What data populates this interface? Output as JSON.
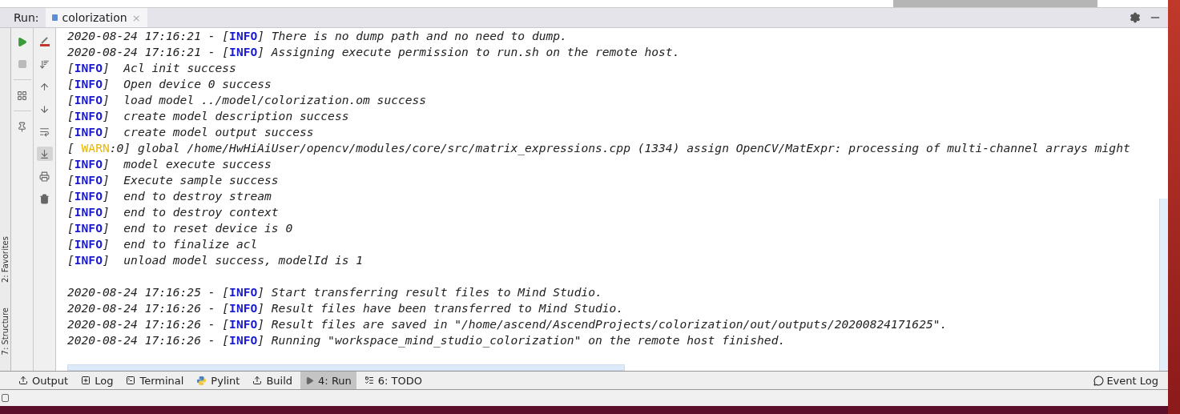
{
  "run_header": {
    "label": "Run:",
    "tabs": [
      {
        "label": "colorization",
        "close": "×",
        "selected": true
      }
    ]
  },
  "console": {
    "lines": [
      {
        "kind": "info",
        "pre": "2020-08-24 17:16:21 - [",
        "tag": "INFO",
        "post": "] There is no dump path and no need to dump."
      },
      {
        "kind": "info",
        "pre": "2020-08-24 17:16:21 - [",
        "tag": "INFO",
        "post": "] Assigning execute permission to run.sh on the remote host."
      },
      {
        "kind": "info",
        "pre": "[",
        "tag": "INFO",
        "post": "]  Acl init success"
      },
      {
        "kind": "info",
        "pre": "[",
        "tag": "INFO",
        "post": "]  Open device 0 success"
      },
      {
        "kind": "info",
        "pre": "[",
        "tag": "INFO",
        "post": "]  load model ../model/colorization.om success"
      },
      {
        "kind": "info",
        "pre": "[",
        "tag": "INFO",
        "post": "]  create model description success"
      },
      {
        "kind": "info",
        "pre": "[",
        "tag": "INFO",
        "post": "]  create model output success"
      },
      {
        "kind": "warn",
        "pre": "[ ",
        "tag": "WARN",
        "post": ":0] global /home/HwHiAiUser/opencv/modules/core/src/matrix_expressions.cpp (1334) assign OpenCV/MatExpr: processing of multi-channel arrays might"
      },
      {
        "kind": "info",
        "pre": "[",
        "tag": "INFO",
        "post": "]  model execute success"
      },
      {
        "kind": "info",
        "pre": "[",
        "tag": "INFO",
        "post": "]  Execute sample success"
      },
      {
        "kind": "info",
        "pre": "[",
        "tag": "INFO",
        "post": "]  end to destroy stream"
      },
      {
        "kind": "info",
        "pre": "[",
        "tag": "INFO",
        "post": "]  end to destroy context"
      },
      {
        "kind": "info",
        "pre": "[",
        "tag": "INFO",
        "post": "]  end to reset device is 0"
      },
      {
        "kind": "info",
        "pre": "[",
        "tag": "INFO",
        "post": "]  end to finalize acl"
      },
      {
        "kind": "info",
        "pre": "[",
        "tag": "INFO",
        "post": "]  unload model success, modelId is 1"
      },
      {
        "kind": "blank"
      },
      {
        "kind": "info",
        "pre": "2020-08-24 17:16:25 - [",
        "tag": "INFO",
        "post": "] Start transferring result files to Mind Studio."
      },
      {
        "kind": "info",
        "pre": "2020-08-24 17:16:26 - [",
        "tag": "INFO",
        "post": "] Result files have been transferred to Mind Studio."
      },
      {
        "kind": "info",
        "pre": "2020-08-24 17:16:26 - [",
        "tag": "INFO",
        "post": "] Result files are saved in \"/home/ascend/AscendProjects/colorization/out/outputs/20200824171625\"."
      },
      {
        "kind": "info",
        "pre": "2020-08-24 17:16:26 - [",
        "tag": "INFO",
        "post": "] Running \"workspace_mind_studio_colorization\" on the remote host finished."
      }
    ]
  },
  "side_tabs": [
    {
      "label": "2: Favorites"
    },
    {
      "label": "7: Structure"
    }
  ],
  "tool_tabs": [
    {
      "kind": "output",
      "label": "Output",
      "selected": false
    },
    {
      "kind": "log",
      "label": "Log",
      "selected": false
    },
    {
      "kind": "terminal",
      "label": "Terminal",
      "selected": false
    },
    {
      "kind": "python",
      "label": "Pylint",
      "selected": false
    },
    {
      "kind": "build",
      "label": "Build",
      "selected": false
    },
    {
      "kind": "run",
      "label": "4: Run",
      "selected": true
    },
    {
      "kind": "todo",
      "label": "6: TODO",
      "selected": false
    }
  ],
  "event_log": {
    "label": "Event Log"
  }
}
